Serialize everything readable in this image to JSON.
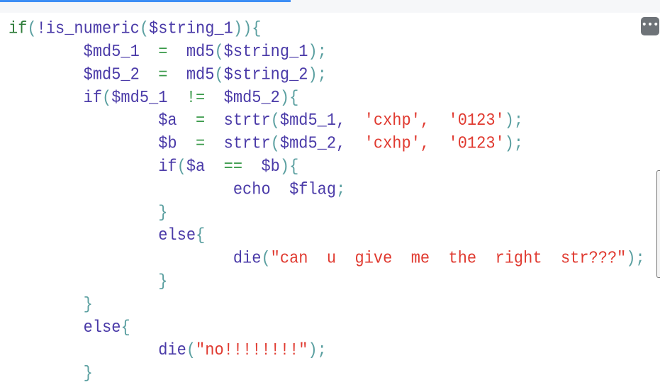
{
  "progress_percent": 44,
  "more_button_label": "•••",
  "code_lines": [
    [
      [
        "if",
        "k"
      ],
      [
        "(",
        "p"
      ],
      [
        "!is_numeric",
        "v"
      ],
      [
        "(",
        "p"
      ],
      [
        "$string_1",
        "v"
      ],
      [
        "))",
        "p"
      ],
      [
        "{",
        "p"
      ]
    ],
    [
      [
        "\t$md5_1",
        "v"
      ],
      [
        "  =  ",
        "o"
      ],
      [
        "md5",
        "v"
      ],
      [
        "(",
        "p"
      ],
      [
        "$string_1",
        "v"
      ],
      [
        ");",
        "p"
      ]
    ],
    [
      [
        "\t$md5_2",
        "v"
      ],
      [
        "  =  ",
        "o"
      ],
      [
        "md5",
        "v"
      ],
      [
        "(",
        "p"
      ],
      [
        "$string_2",
        "v"
      ],
      [
        ");",
        "p"
      ]
    ],
    [
      [
        "\tif",
        "v"
      ],
      [
        "(",
        "p"
      ],
      [
        "$md5_1",
        "v"
      ],
      [
        "  !=  ",
        "o"
      ],
      [
        "$md5_2",
        "v"
      ],
      [
        ")",
        "p"
      ],
      [
        "{",
        "p"
      ]
    ],
    [
      [
        "\t\t$a",
        "v"
      ],
      [
        "  =  ",
        "o"
      ],
      [
        "strtr",
        "v"
      ],
      [
        "(",
        "p"
      ],
      [
        "$md5_1,",
        "v"
      ],
      [
        "  'cxhp',  '0123'",
        "s"
      ],
      [
        ");",
        "p"
      ]
    ],
    [
      [
        "\t\t$b",
        "v"
      ],
      [
        "  =  ",
        "o"
      ],
      [
        "strtr",
        "v"
      ],
      [
        "(",
        "p"
      ],
      [
        "$md5_2,",
        "v"
      ],
      [
        "  'cxhp',  '0123'",
        "s"
      ],
      [
        ");",
        "p"
      ]
    ],
    [
      [
        "\t\tif",
        "v"
      ],
      [
        "(",
        "p"
      ],
      [
        "$a",
        "v"
      ],
      [
        "  ==  ",
        "o"
      ],
      [
        "$b",
        "v"
      ],
      [
        ")",
        "p"
      ],
      [
        "{",
        "p"
      ]
    ],
    [
      [
        "\t\t\techo  $flag",
        "v"
      ],
      [
        ";",
        "p"
      ]
    ],
    [
      [
        "\t\t}",
        "p"
      ]
    ],
    [
      [
        "\t\telse",
        "v"
      ],
      [
        "{",
        "p"
      ]
    ],
    [
      [
        "\t\t\tdie",
        "v"
      ],
      [
        "(",
        "p"
      ],
      [
        "\"can  u  give  me  the  right  str???\"",
        "s"
      ],
      [
        ");",
        "p"
      ]
    ],
    [
      [
        "\t\t}",
        "p"
      ]
    ],
    [
      [
        "\t}",
        "p"
      ]
    ],
    [
      [
        "\telse",
        "v"
      ],
      [
        "{",
        "p"
      ]
    ],
    [
      [
        "\t\tdie",
        "v"
      ],
      [
        "(",
        "p"
      ],
      [
        "\"no!!!!!!!!\"",
        "s"
      ],
      [
        ");",
        "p"
      ]
    ],
    [
      [
        "\t}",
        "p"
      ]
    ]
  ]
}
